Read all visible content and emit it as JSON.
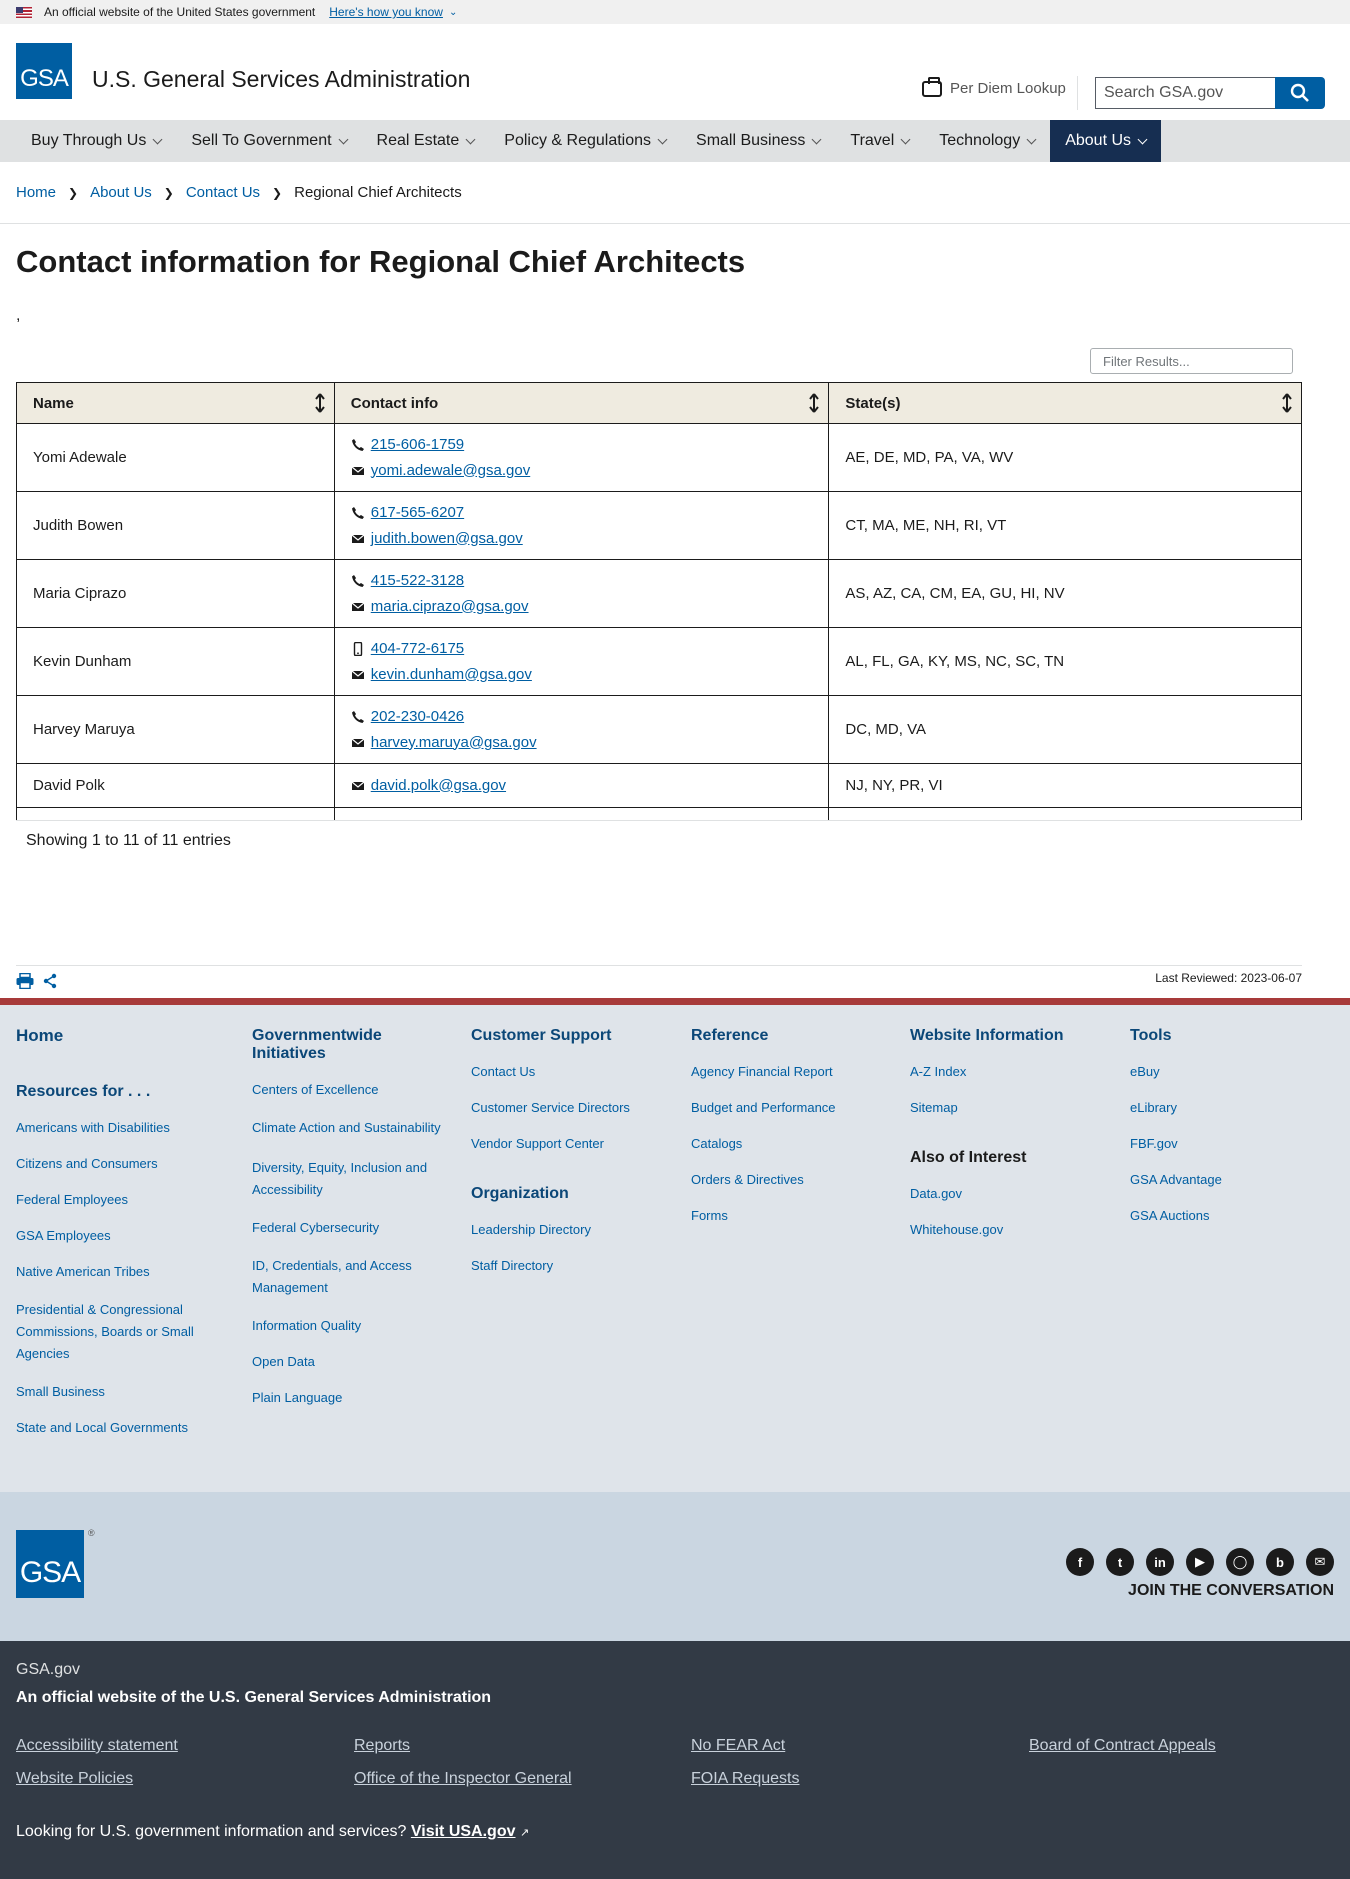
{
  "banner": {
    "text": "An official website of the United States government",
    "link": "Here's how you know"
  },
  "header": {
    "logo": "GSA",
    "title": "U.S. General Services Administration",
    "per_diem": "Per Diem Lookup",
    "search_placeholder": "Search GSA.gov"
  },
  "nav": [
    {
      "label": "Buy Through Us"
    },
    {
      "label": "Sell To Government"
    },
    {
      "label": "Real Estate"
    },
    {
      "label": "Policy & Regulations"
    },
    {
      "label": "Small Business"
    },
    {
      "label": "Travel"
    },
    {
      "label": "Technology"
    },
    {
      "label": "About Us",
      "active": true
    }
  ],
  "breadcrumb": [
    "Home",
    "About Us",
    "Contact Us",
    "Regional Chief Architects"
  ],
  "page": {
    "title": "Contact information for Regional Chief Architects",
    "stray": ",",
    "filter_placeholder": "Filter Results...",
    "info": "Showing 1 to 11 of 11 entries",
    "last_reviewed": "Last Reviewed: 2023-06-07"
  },
  "table": {
    "headers": [
      "Name",
      "Contact info",
      "State(s)"
    ],
    "rows": [
      {
        "name": "Yomi Adewale",
        "phone": "215-606-1759",
        "phone_type": "phone",
        "email": "yomi.adewale@gsa.gov",
        "states": "AE, DE, MD, PA, VA, WV"
      },
      {
        "name": "Judith Bowen",
        "phone": "617-565-6207",
        "phone_type": "phone",
        "email": "judith.bowen@gsa.gov",
        "states": "CT, MA, ME, NH, RI, VT"
      },
      {
        "name": "Maria Ciprazo",
        "phone": "415-522-3128",
        "phone_type": "phone",
        "email": "maria.ciprazo@gsa.gov",
        "states": "AS, AZ, CA, CM, EA, GU, HI, NV"
      },
      {
        "name": "Kevin Dunham",
        "phone": "404-772-6175",
        "phone_type": "mobile",
        "email": "kevin.dunham@gsa.gov",
        "states": "AL, FL, GA, KY, MS, NC, SC, TN"
      },
      {
        "name": "Harvey Maruya",
        "phone": "202-230-0426",
        "phone_type": "phone",
        "email": "harvey.maruya@gsa.gov",
        "states": "DC, MD, VA"
      },
      {
        "name": "David Polk",
        "phone": "",
        "phone_type": "",
        "email": "david.polk@gsa.gov",
        "states": "NJ, NY, PR, VI"
      }
    ]
  },
  "footer": {
    "home": "Home",
    "resources_head": "Resources for . . .",
    "resources": [
      "Americans with Disabilities",
      "Citizens and Consumers",
      "Federal Employees",
      "GSA Employees",
      "Native American Tribes",
      "Presidential & Congressional Commissions, Boards or Small Agencies",
      "Small Business",
      "State and Local Governments"
    ],
    "govwide_head": "Governmentwide Initiatives",
    "govwide": [
      "Centers of Excellence",
      "Climate Action and Sustainability",
      "Diversity, Equity, Inclusion and Accessibility",
      "Federal Cybersecurity",
      "ID, Credentials, and Access Management",
      "Information Quality",
      "Open Data",
      "Plain Language"
    ],
    "support_head": "Customer Support",
    "support": [
      "Contact Us",
      "Customer Service Directors",
      "Vendor Support Center"
    ],
    "org_head": "Organization",
    "org": [
      "Leadership Directory",
      "Staff Directory"
    ],
    "reference_head": "Reference",
    "reference": [
      "Agency Financial Report",
      "Budget and Performance",
      "Catalogs",
      "Orders & Directives",
      "Forms"
    ],
    "website_head": "Website Information",
    "website": [
      "A-Z Index",
      "Sitemap"
    ],
    "interest_head": "Also of Interest",
    "interest": [
      "Data.gov",
      "Whitehouse.gov"
    ],
    "tools_head": "Tools",
    "tools": [
      "eBuy",
      "eLibrary",
      "FBF.gov",
      "GSA Advantage",
      "GSA Auctions"
    ],
    "logo": "GSA",
    "reg_mark": "®",
    "social": [
      "facebook-icon",
      "twitter-icon",
      "linkedin-icon",
      "youtube-icon",
      "instagram-icon",
      "blog-icon",
      "email-icon"
    ],
    "join": "JOIN THE CONVERSATION",
    "gsa_gov": "GSA.gov",
    "official": "An official website of the U.S. General Services Administration",
    "legal": [
      "Accessibility statement",
      "Reports",
      "No FEAR Act",
      "Board of Contract Appeals",
      "Website Policies",
      "Office of the Inspector General",
      "FOIA Requests"
    ],
    "usa_text": "Looking for U.S. government information and services?",
    "usa_link": "Visit USA.gov"
  }
}
